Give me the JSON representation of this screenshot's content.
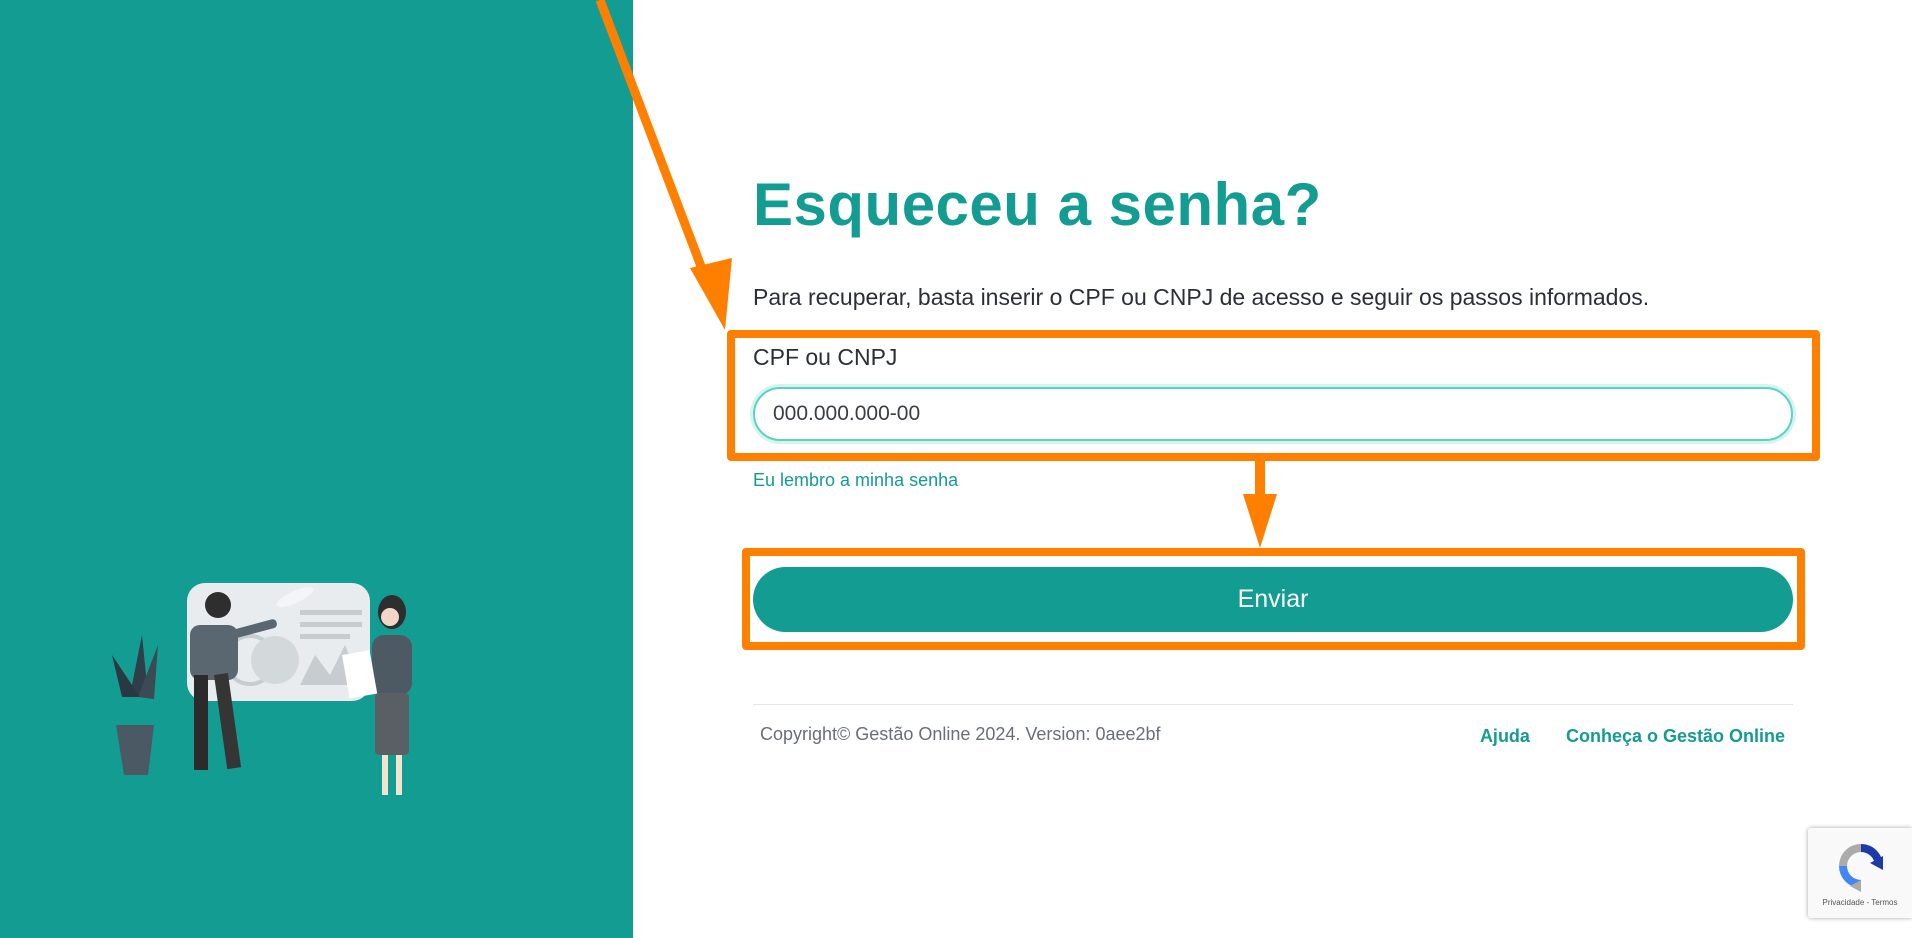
{
  "form": {
    "title": "Esqueceu a senha?",
    "subtitle": "Para recuperar, basta inserir o CPF ou CNPJ de acesso e seguir os passos informados.",
    "field_label": "CPF ou CNPJ",
    "field_placeholder": "000.000.000-00",
    "field_value": "",
    "remember_link": "Eu lembro a minha senha",
    "submit_label": "Enviar"
  },
  "footer": {
    "copyright": "Copyright© Gestão Online 2024. Version: 0aee2bf",
    "links": [
      "Ajuda",
      "Conheça o Gestão Online"
    ]
  },
  "recaptcha": {
    "text": "Privacidade - Termos",
    "icon": "recaptcha-icon"
  },
  "illustration": {
    "icon": "people-presentation-illustration"
  },
  "colors": {
    "brand": "#139c92",
    "annotation": "#ff8000",
    "input_focus": "#59d3c5"
  }
}
